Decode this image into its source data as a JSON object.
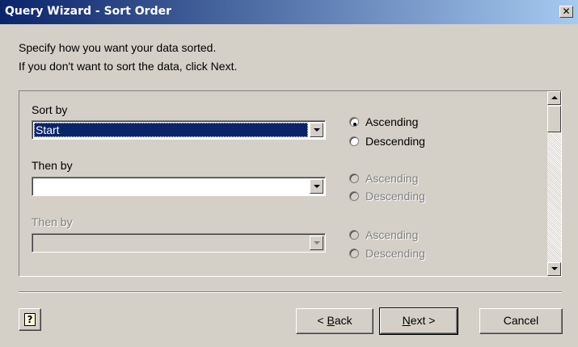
{
  "window": {
    "title": "Query Wizard - Sort Order",
    "close_label": "✕"
  },
  "instructions": [
    "Specify how you want your data sorted.",
    "If you don't want to sort the data, click Next."
  ],
  "sort_rows": [
    {
      "label": "Sort by",
      "value": "Start",
      "enabled": true,
      "ascending_label": "Ascending",
      "descending_label": "Descending",
      "selected_order": "Ascending"
    },
    {
      "label": "Then by",
      "value": "",
      "enabled": true,
      "options_enabled": false,
      "ascending_label": "Ascending",
      "descending_label": "Descending",
      "selected_order": ""
    },
    {
      "label": "Then by",
      "value": "",
      "enabled": false,
      "ascending_label": "Ascending",
      "descending_label": "Descending",
      "selected_order": ""
    }
  ],
  "buttons": {
    "help_icon": "?",
    "back": {
      "prefix": "< ",
      "mnemonic": "B",
      "rest": "ack"
    },
    "next": {
      "mnemonic": "N",
      "rest": "ext >"
    },
    "cancel": "Cancel"
  },
  "colors": {
    "titlebar_start": "#0a246a",
    "titlebar_end": "#a6caf0",
    "selection": "#0a246a",
    "face": "#d4d0c8"
  }
}
